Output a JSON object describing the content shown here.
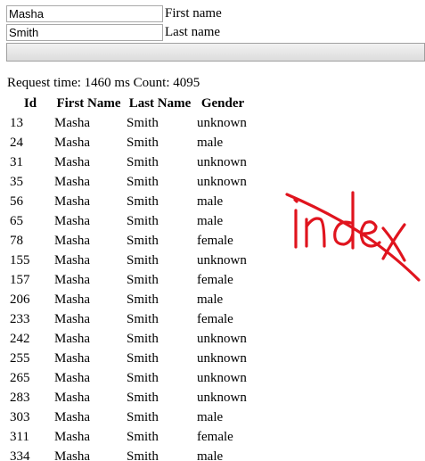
{
  "form": {
    "first_name_value": "Masha",
    "first_name_label": "First name",
    "last_name_value": "Smith",
    "last_name_label": "Last name"
  },
  "status": "Request time: 1460 ms Count: 4095",
  "table": {
    "headers": {
      "id": "Id",
      "first_name": "First Name",
      "last_name": "Last Name",
      "gender": "Gender"
    },
    "rows": [
      {
        "id": "13",
        "first_name": "Masha",
        "last_name": "Smith",
        "gender": "unknown"
      },
      {
        "id": "24",
        "first_name": "Masha",
        "last_name": "Smith",
        "gender": "male"
      },
      {
        "id": "31",
        "first_name": "Masha",
        "last_name": "Smith",
        "gender": "unknown"
      },
      {
        "id": "35",
        "first_name": "Masha",
        "last_name": "Smith",
        "gender": "unknown"
      },
      {
        "id": "56",
        "first_name": "Masha",
        "last_name": "Smith",
        "gender": "male"
      },
      {
        "id": "65",
        "first_name": "Masha",
        "last_name": "Smith",
        "gender": "male"
      },
      {
        "id": "78",
        "first_name": "Masha",
        "last_name": "Smith",
        "gender": "female"
      },
      {
        "id": "155",
        "first_name": "Masha",
        "last_name": "Smith",
        "gender": "unknown"
      },
      {
        "id": "157",
        "first_name": "Masha",
        "last_name": "Smith",
        "gender": "female"
      },
      {
        "id": "206",
        "first_name": "Masha",
        "last_name": "Smith",
        "gender": "male"
      },
      {
        "id": "233",
        "first_name": "Masha",
        "last_name": "Smith",
        "gender": "female"
      },
      {
        "id": "242",
        "first_name": "Masha",
        "last_name": "Smith",
        "gender": "unknown"
      },
      {
        "id": "255",
        "first_name": "Masha",
        "last_name": "Smith",
        "gender": "unknown"
      },
      {
        "id": "265",
        "first_name": "Masha",
        "last_name": "Smith",
        "gender": "unknown"
      },
      {
        "id": "283",
        "first_name": "Masha",
        "last_name": "Smith",
        "gender": "unknown"
      },
      {
        "id": "303",
        "first_name": "Masha",
        "last_name": "Smith",
        "gender": "male"
      },
      {
        "id": "311",
        "first_name": "Masha",
        "last_name": "Smith",
        "gender": "female"
      },
      {
        "id": "334",
        "first_name": "Masha",
        "last_name": "Smith",
        "gender": "male"
      }
    ]
  },
  "annotation": {
    "text": "index",
    "color": "#e0141e"
  }
}
